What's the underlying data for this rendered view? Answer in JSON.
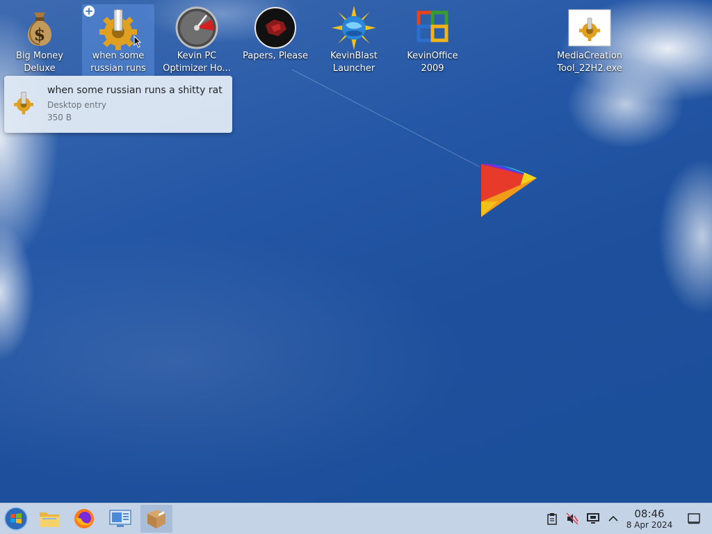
{
  "desktop": {
    "icons": [
      {
        "label": "Big Money Deluxe",
        "icon": "money-bag-icon"
      },
      {
        "label": "when some russian runs a...",
        "icon": "gear-icon"
      },
      {
        "label": "Kevin PC Optimizer Ho...",
        "icon": "speedometer-icon"
      },
      {
        "label": "Papers, Please",
        "icon": "papers-please-icon"
      },
      {
        "label": "KevinBlast Launcher",
        "icon": "sun-globe-icon"
      },
      {
        "label": "KevinOffice 2009",
        "icon": "office-icon"
      },
      {
        "label": "MediaCreation Tool_22H2.exe",
        "icon": "exe-gear-icon"
      }
    ]
  },
  "tooltip": {
    "title": "when some russian runs a shitty rat",
    "type": "Desktop entry",
    "size": "350 B"
  },
  "taskbar": {
    "items": [
      {
        "icon": "start-menu-icon"
      },
      {
        "icon": "file-manager-icon"
      },
      {
        "icon": "firefox-icon"
      },
      {
        "icon": "system-settings-icon"
      },
      {
        "icon": "package-icon"
      }
    ],
    "tray": [
      {
        "icon": "clipboard-icon"
      },
      {
        "icon": "volume-muted-icon"
      },
      {
        "icon": "display-icon"
      },
      {
        "icon": "chevron-up-icon"
      }
    ],
    "clock": {
      "time": "08:46",
      "date": "8 Apr 2024"
    },
    "show_desktop_icon": "show-desktop-icon"
  },
  "colors": {
    "wallpaper": "#1d4f9c",
    "taskbar": "#c4d3e6",
    "selection": "#6496e6",
    "tooltip": "#dfe8f4"
  }
}
